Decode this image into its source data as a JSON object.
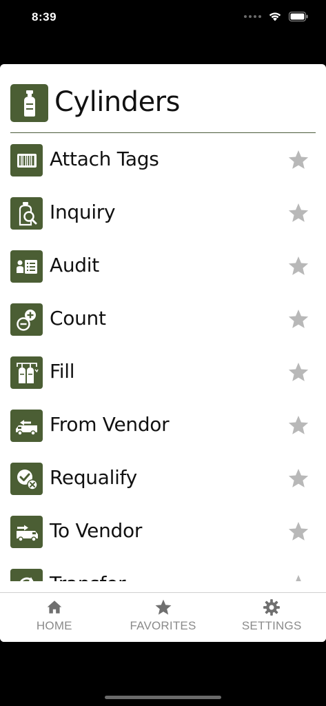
{
  "status_bar": {
    "time": "8:39"
  },
  "header": {
    "title": "Cylinders"
  },
  "menu": {
    "items": [
      {
        "label": "Attach Tags",
        "icon": "barcode-tag-icon"
      },
      {
        "label": "Inquiry",
        "icon": "cylinder-search-icon"
      },
      {
        "label": "Audit",
        "icon": "audit-checklist-icon"
      },
      {
        "label": "Count",
        "icon": "count-plus-minus-icon"
      },
      {
        "label": "Fill",
        "icon": "fill-cylinders-icon"
      },
      {
        "label": "From Vendor",
        "icon": "truck-incoming-icon"
      },
      {
        "label": "Requalify",
        "icon": "requalify-check-icon"
      },
      {
        "label": "To Vendor",
        "icon": "truck-outgoing-icon"
      },
      {
        "label": "Transfer",
        "icon": "transfer-icon"
      }
    ]
  },
  "tabs": [
    {
      "label": "HOME",
      "icon": "home-icon"
    },
    {
      "label": "FAVORITES",
      "icon": "star-icon"
    },
    {
      "label": "SETTINGS",
      "icon": "gear-icon"
    }
  ],
  "colors": {
    "accent": "#4b5e34",
    "star_inactive": "#b8b8b8",
    "tab_text": "#8a8a8a"
  }
}
